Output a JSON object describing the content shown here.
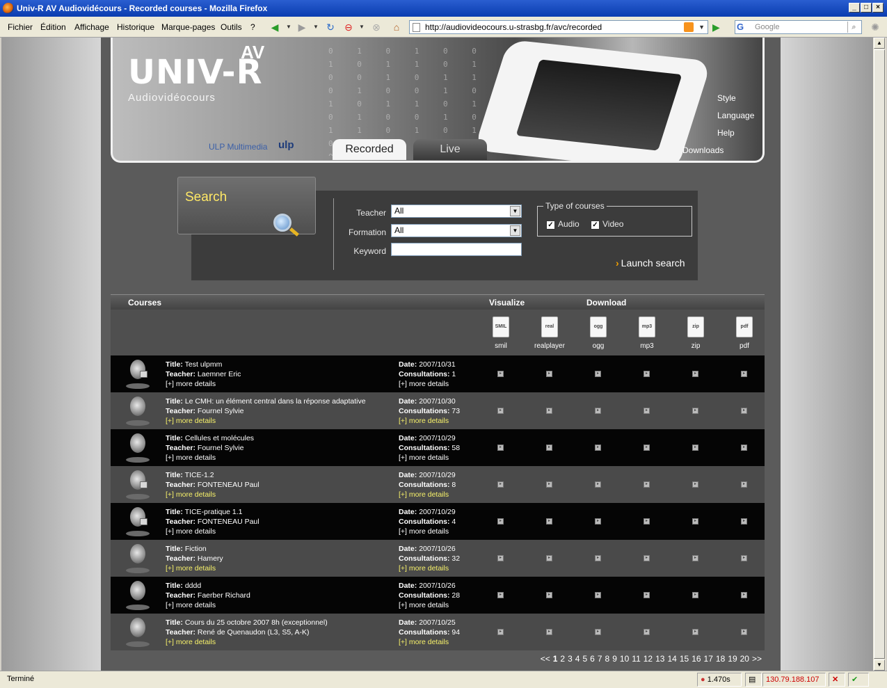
{
  "window": {
    "title": "Univ-R AV Audiovidécours - Recorded courses - Mozilla Firefox"
  },
  "menu": [
    "Fichier",
    "Édition",
    "Affichage",
    "Historique",
    "Marque-pages",
    "Outils",
    "?"
  ],
  "url": "http://audiovideocours.u-strasbg.fr/avc/recorded",
  "google_placeholder": "Google",
  "header": {
    "logo": "UNIV-R",
    "logo_sup": "AV",
    "subtitle": "Audiovidéocours",
    "ulp_multimedia": "ULP Multimedia",
    "ulp": "ulp",
    "links": [
      "Style",
      "Language",
      "Help",
      "Downloads"
    ],
    "tabs": {
      "recorded": "Recorded",
      "live": "Live"
    }
  },
  "search": {
    "title": "Search",
    "teacher_label": "Teacher",
    "teacher_value": "All",
    "formation_label": "Formation",
    "formation_value": "All",
    "keyword_label": "Keyword",
    "type_legend": "Type of courses",
    "audio_label": "Audio",
    "video_label": "Video",
    "audio_checked": true,
    "video_checked": true,
    "launch": "Launch search"
  },
  "table": {
    "courses": "Courses",
    "visualize": "Visualize",
    "download": "Download",
    "formats": [
      {
        "label": "smil",
        "icon": "smil-icon",
        "badge": "SMIL"
      },
      {
        "label": "realplayer",
        "icon": "realplayer-icon",
        "badge": "real"
      },
      {
        "label": "ogg",
        "icon": "ogg-icon",
        "badge": "ogg"
      },
      {
        "label": "mp3",
        "icon": "mp3-icon",
        "badge": "mp3"
      },
      {
        "label": "zip",
        "icon": "zip-icon",
        "badge": "zip"
      },
      {
        "label": "pdf",
        "icon": "pdf-icon",
        "badge": "pdf"
      }
    ],
    "labels": {
      "title": "Title:",
      "teacher": "Teacher:",
      "date": "Date:",
      "consultations": "Consultations:",
      "more": "[+] more details"
    },
    "rows": [
      {
        "title": "Test ulpmm",
        "teacher": "Laemner Eric",
        "date": "2007/10/31",
        "consultations": "1",
        "locked": true
      },
      {
        "title": "Le CMH: un élément central dans la réponse adaptative",
        "teacher": "Fournel Sylvie",
        "date": "2007/10/30",
        "consultations": "73",
        "locked": false
      },
      {
        "title": "Cellules et molécules",
        "teacher": "Fournel Sylvie",
        "date": "2007/10/29",
        "consultations": "58",
        "locked": false
      },
      {
        "title": "TICE-1.2",
        "teacher": "FONTENEAU Paul",
        "date": "2007/10/29",
        "consultations": "8",
        "locked": true
      },
      {
        "title": "TICE-pratique 1.1",
        "teacher": "FONTENEAU Paul",
        "date": "2007/10/29",
        "consultations": "4",
        "locked": true
      },
      {
        "title": "Fiction",
        "teacher": "Hamery",
        "date": "2007/10/26",
        "consultations": "32",
        "locked": false
      },
      {
        "title": "dddd",
        "teacher": "Faerber Richard",
        "date": "2007/10/26",
        "consultations": "28",
        "locked": false
      },
      {
        "title": "Cours du 25 octobre 2007 8h (exceptionnel)",
        "teacher": "René de Quenaudon (L3, S5, A-K)",
        "date": "2007/10/25",
        "consultations": "94",
        "locked": false
      }
    ]
  },
  "pager": {
    "prev": "<<",
    "pages": [
      "1",
      "2",
      "3",
      "4",
      "5",
      "6",
      "7",
      "8",
      "9",
      "10",
      "11",
      "12",
      "13",
      "14",
      "15",
      "16",
      "17",
      "18",
      "19",
      "20"
    ],
    "current": "1",
    "next": ">>"
  },
  "status": {
    "text": "Terminé",
    "time": "1.470s",
    "ip": "130.79.188.107"
  }
}
